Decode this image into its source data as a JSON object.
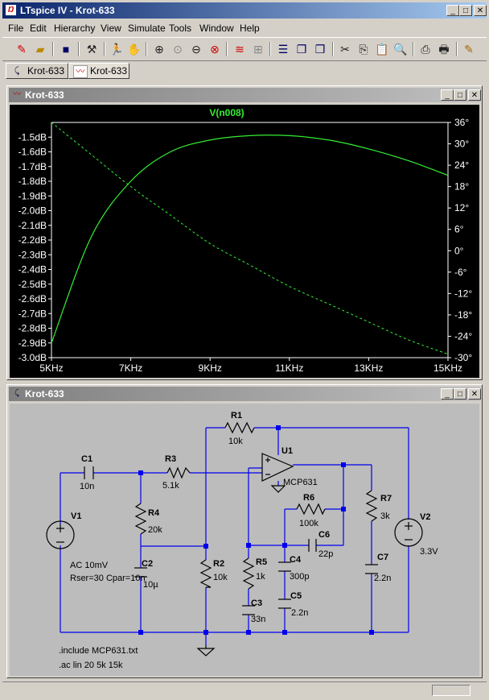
{
  "app": {
    "title": "LTspice IV - Krot-633"
  },
  "menu": [
    "File",
    "Edit",
    "Hierarchy",
    "View",
    "Simulate",
    "Tools",
    "Window",
    "Help"
  ],
  "toolbar_icons": [
    "new-schematic-icon",
    "open-icon",
    "save-icon",
    "control-panel-icon",
    "run-icon",
    "halt-icon",
    "zoom-in-icon",
    "zoom-fit-icon",
    "zoom-out-icon",
    "zoom-cancel-icon",
    "autorange-icon",
    "grid-icon",
    "tile-horizontal-icon",
    "cascade-icon",
    "tile-vertical-icon",
    "cut-icon",
    "copy-icon",
    "paste-icon",
    "find-icon",
    "print-preview-icon",
    "print-icon",
    "pencil-icon"
  ],
  "tabs": [
    {
      "label": "Krot-633",
      "icon": "schematic-icon"
    },
    {
      "label": "Krot-633",
      "icon": "waveform-icon"
    }
  ],
  "plot_window": {
    "title": "Krot-633"
  },
  "schematic_window": {
    "title": "Krot-633"
  },
  "chart_data": {
    "type": "line",
    "title": "V(n008)",
    "x": [
      5,
      6,
      7,
      8,
      9,
      10,
      11,
      12,
      13,
      14,
      15
    ],
    "x_ticks": [
      "5KHz",
      "7KHz",
      "9KHz",
      "11KHz",
      "13KHz",
      "15KHz"
    ],
    "x_tick_values": [
      5,
      7,
      9,
      11,
      13,
      15
    ],
    "xlim": [
      5,
      15
    ],
    "left_axis": {
      "ylim": [
        -3.0,
        -1.4
      ],
      "ticks": [
        "-1.5dB",
        "-1.6dB",
        "-1.7dB",
        "-1.8dB",
        "-1.9dB",
        "-2.0dB",
        "-2.1dB",
        "-2.2dB",
        "-2.3dB",
        "-2.4dB",
        "-2.5dB",
        "-2.6dB",
        "-2.7dB",
        "-2.8dB",
        "-2.9dB",
        "-3.0dB"
      ],
      "tick_values": [
        -1.5,
        -1.6,
        -1.7,
        -1.8,
        -1.9,
        -2.0,
        -2.1,
        -2.2,
        -2.3,
        -2.4,
        -2.5,
        -2.6,
        -2.7,
        -2.8,
        -2.9,
        -3.0
      ]
    },
    "right_axis": {
      "ylim": [
        -30,
        36
      ],
      "ticks": [
        "36°",
        "30°",
        "24°",
        "18°",
        "12°",
        "6°",
        "0°",
        "-6°",
        "-12°",
        "-18°",
        "-24°",
        "-30°"
      ],
      "tick_values": [
        36,
        30,
        24,
        18,
        12,
        6,
        0,
        -6,
        -12,
        -18,
        -24,
        -30
      ]
    },
    "series": [
      {
        "style": "solid",
        "axis": "left",
        "values": [
          -2.9,
          -2.18,
          -1.8,
          -1.6,
          -1.52,
          -1.49,
          -1.49,
          -1.52,
          -1.58,
          -1.66,
          -1.76
        ]
      },
      {
        "style": "dashed",
        "axis": "right",
        "values": [
          36,
          27,
          18,
          10,
          2,
          -4,
          -10,
          -15,
          -20,
          -25,
          -29
        ]
      }
    ],
    "colors": {
      "line": "#33ee33",
      "background": "#000000",
      "axis_text": "#ffffff"
    }
  },
  "schematic": {
    "components": [
      {
        "ref": "R1",
        "value": "10k"
      },
      {
        "ref": "C1",
        "value": "10n"
      },
      {
        "ref": "R3",
        "value": "5.1k"
      },
      {
        "ref": "U1",
        "value": "MCP631"
      },
      {
        "ref": "R6",
        "value": "100k"
      },
      {
        "ref": "R7",
        "value": "3k"
      },
      {
        "ref": "V1",
        "value": ""
      },
      {
        "ref": "R4",
        "value": "20k"
      },
      {
        "ref": "C6",
        "value": "22p"
      },
      {
        "ref": "V2",
        "value": "3.3V"
      },
      {
        "ref": "C2",
        "value": "10µ"
      },
      {
        "ref": "R2",
        "value": "10k"
      },
      {
        "ref": "R5",
        "value": "1k"
      },
      {
        "ref": "C4",
        "value": "300p"
      },
      {
        "ref": "C7",
        "value": "2.2n"
      },
      {
        "ref": "C3",
        "value": "33n"
      },
      {
        "ref": "C5",
        "value": "2.2n"
      }
    ],
    "v1_params": [
      "AC 10mV",
      "Rser=30 Cpar=10n"
    ],
    "directives": [
      ".include MCP631.txt",
      ".ac lin 20 5k 15k"
    ]
  }
}
